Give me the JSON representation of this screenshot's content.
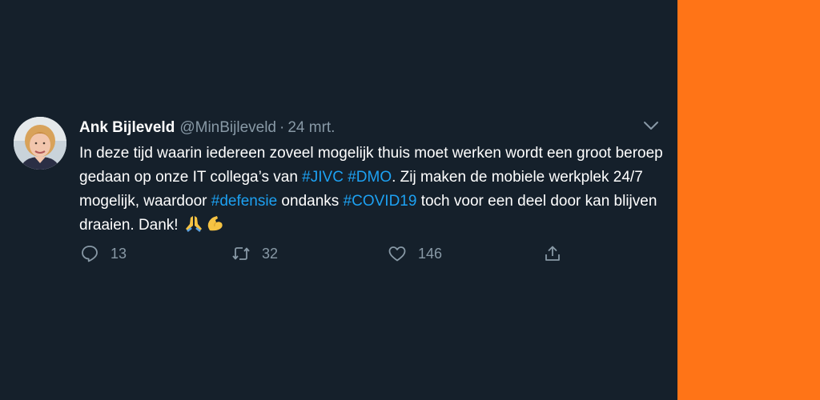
{
  "tweet": {
    "author_name": "Ank Bijleveld",
    "handle": "@MinBijleveld",
    "separator": "·",
    "date": "24 mrt.",
    "text": {
      "seg1": "In deze tijd waarin iedereen zoveel mogelijk thuis moet werken wordt een groot beroep gedaan op onze IT collega’s van ",
      "tag1": "#JIVC",
      "seg2": " ",
      "tag2": "#DMO",
      "seg3": ". Zij maken de mobiele werkplek 24/7 mogelijk,  waardoor ",
      "tag3": "#defensie",
      "seg4": " ondanks ",
      "tag4": "#COVID19",
      "seg5": " toch voor een deel door kan blijven draaien. Dank! "
    },
    "emojis": [
      "folded-hands-icon",
      "flexed-biceps-icon"
    ],
    "counts": {
      "replies": "13",
      "retweets": "32",
      "likes": "146"
    }
  },
  "colors": {
    "background": "#15202b",
    "accent": "#1da1f2",
    "secondary_text": "#8899a6",
    "side_panel": "#ff7417"
  }
}
